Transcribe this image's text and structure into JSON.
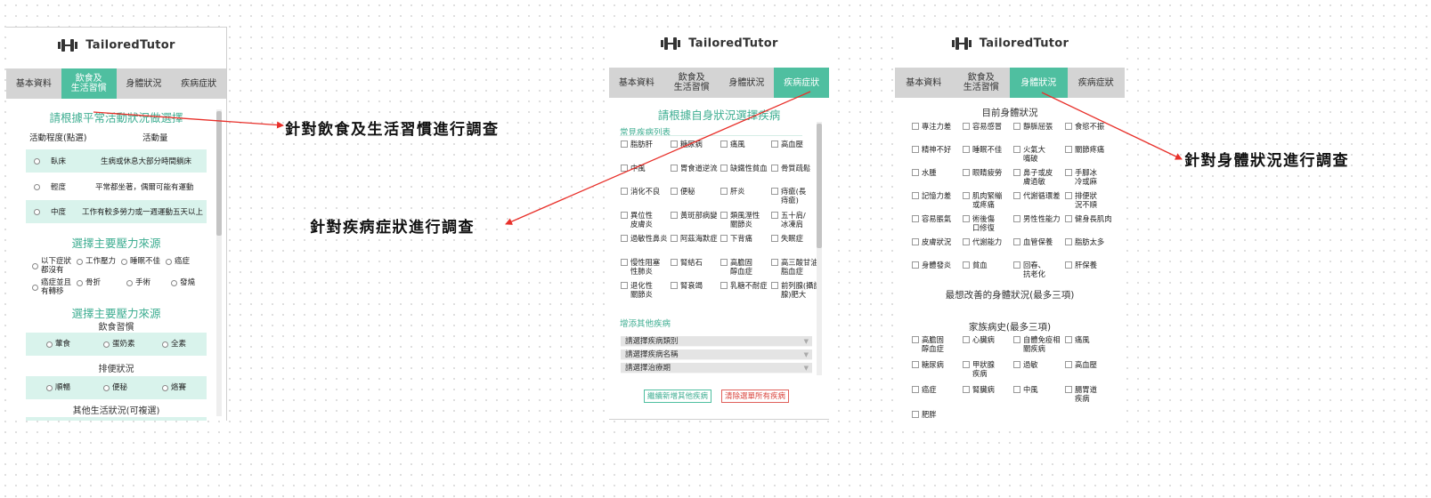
{
  "logo_text": "TailoredTutor",
  "tabs": [
    "基本資料",
    "飲食及\n生活習慣",
    "身體狀況",
    "疾病症狀"
  ],
  "colors": {
    "accent": "#4fbfa0",
    "accent_light": "#d9f3ec",
    "arrow": "#e8302a"
  },
  "panel1": {
    "heading1": "請根據平常活動狀況做選擇",
    "col_header_left": "活動程度(點選)",
    "col_header_right": "活動量",
    "activity": [
      {
        "level": "臥床",
        "desc": "生病或休息大部分時間躺床"
      },
      {
        "level": "輕度",
        "desc": "平常都坐著，偶爾可能有運動"
      },
      {
        "level": "中度",
        "desc": "工作有較多勞力或一週運動五天以上"
      }
    ],
    "heading2": "選擇主要壓力來源",
    "stress_row1": [
      "以下症狀\n都沒有",
      "工作壓力",
      "睡眠不佳",
      "癌症"
    ],
    "stress_row2": [
      "癌症並且\n有轉移",
      "骨折",
      "手術",
      "發燒"
    ],
    "heading3": "選擇主要壓力來源",
    "diet_label": "飲食習慣",
    "diet_options": [
      "葷食",
      "蛋奶素",
      "全素"
    ],
    "bowel_label": "排便狀況",
    "bowel_options": [
      "順暢",
      "便秘",
      "烙賽"
    ],
    "other_label": "其他生活狀況(可複選)"
  },
  "panel2": {
    "heading": "請根據自身狀況選擇疾病",
    "common_label": "常見疾病列表",
    "diseases": [
      [
        "脂肪肝",
        "糖尿病",
        "痛風",
        "高血壓"
      ],
      [
        "中風",
        "胃食道逆流",
        "缺鐵性貧血",
        "骨質疏鬆"
      ],
      [
        "消化不良",
        "便秘",
        "肝炎",
        "痔瘡(長\n痔瘡)"
      ],
      [
        "異位性\n皮膚炎",
        "黃斑部病變",
        "類風溼性\n關節炎",
        "五十肩/\n冰凍肩"
      ],
      [
        "過敏性鼻炎",
        "阿茲海默症",
        "下背痛",
        "失眠症"
      ],
      [
        "慢性阻塞\n性肺炎",
        "腎結石",
        "高膽固\n醇血症",
        "高三酸甘油\n脂血症"
      ],
      [
        "退化性\n關節炎",
        "腎衰竭",
        "乳糖不耐症",
        "前列腺(攝護\n腺)肥大"
      ]
    ],
    "add_label": "增添其他疾病",
    "dropdowns": [
      "請選擇疾病類別",
      "請選擇疾病名稱",
      "請選擇治療期"
    ],
    "btn_add": "繼續新增其他疾病",
    "btn_clear": "清除選單所有疾病"
  },
  "panel3": {
    "heading1": "目前身體狀況",
    "conditions": [
      [
        "專注力差",
        "容易感冒",
        "靜脈屈張",
        "食慾不振"
      ],
      [
        "精神不好",
        "睡眠不佳",
        "火氣大\n嘴破",
        "關節疼痛"
      ],
      [
        "水腫",
        "眼睛疲勞",
        "鼻子或皮\n膚過敏",
        "手腳冰\n冷或麻"
      ],
      [
        "記憶力差",
        "肌肉緊繃\n或疼痛",
        "代謝循環差",
        "排便狀\n況不順"
      ],
      [
        "容易脹氣",
        "術後傷\n口修復",
        "男性性能力",
        "健身長肌肉"
      ],
      [
        "皮膚狀況",
        "代謝能力",
        "血管保養",
        "脂肪太多"
      ],
      [
        "身體發炎",
        "貧血",
        "回春、\n抗老化",
        "肝保養"
      ]
    ],
    "heading2": "最想改善的身體狀況(最多三項)",
    "heading3": "家族病史(最多三項)",
    "family": [
      [
        "高膽固\n醇血症",
        "心臟病",
        "自體免疫相\n關疾病",
        "痛風"
      ],
      [
        "糖尿病",
        "甲狀腺\n疾病",
        "過敏",
        "高血壓"
      ],
      [
        "癌症",
        "腎臟病",
        "中風",
        "腸胃道\n疾病"
      ],
      [
        "肥胖"
      ]
    ]
  },
  "annotations": {
    "diet": "針對飲食及生活習慣進行調查",
    "disease": "針對疾病症狀進行調查",
    "body": "針對身體狀況進行調查"
  }
}
